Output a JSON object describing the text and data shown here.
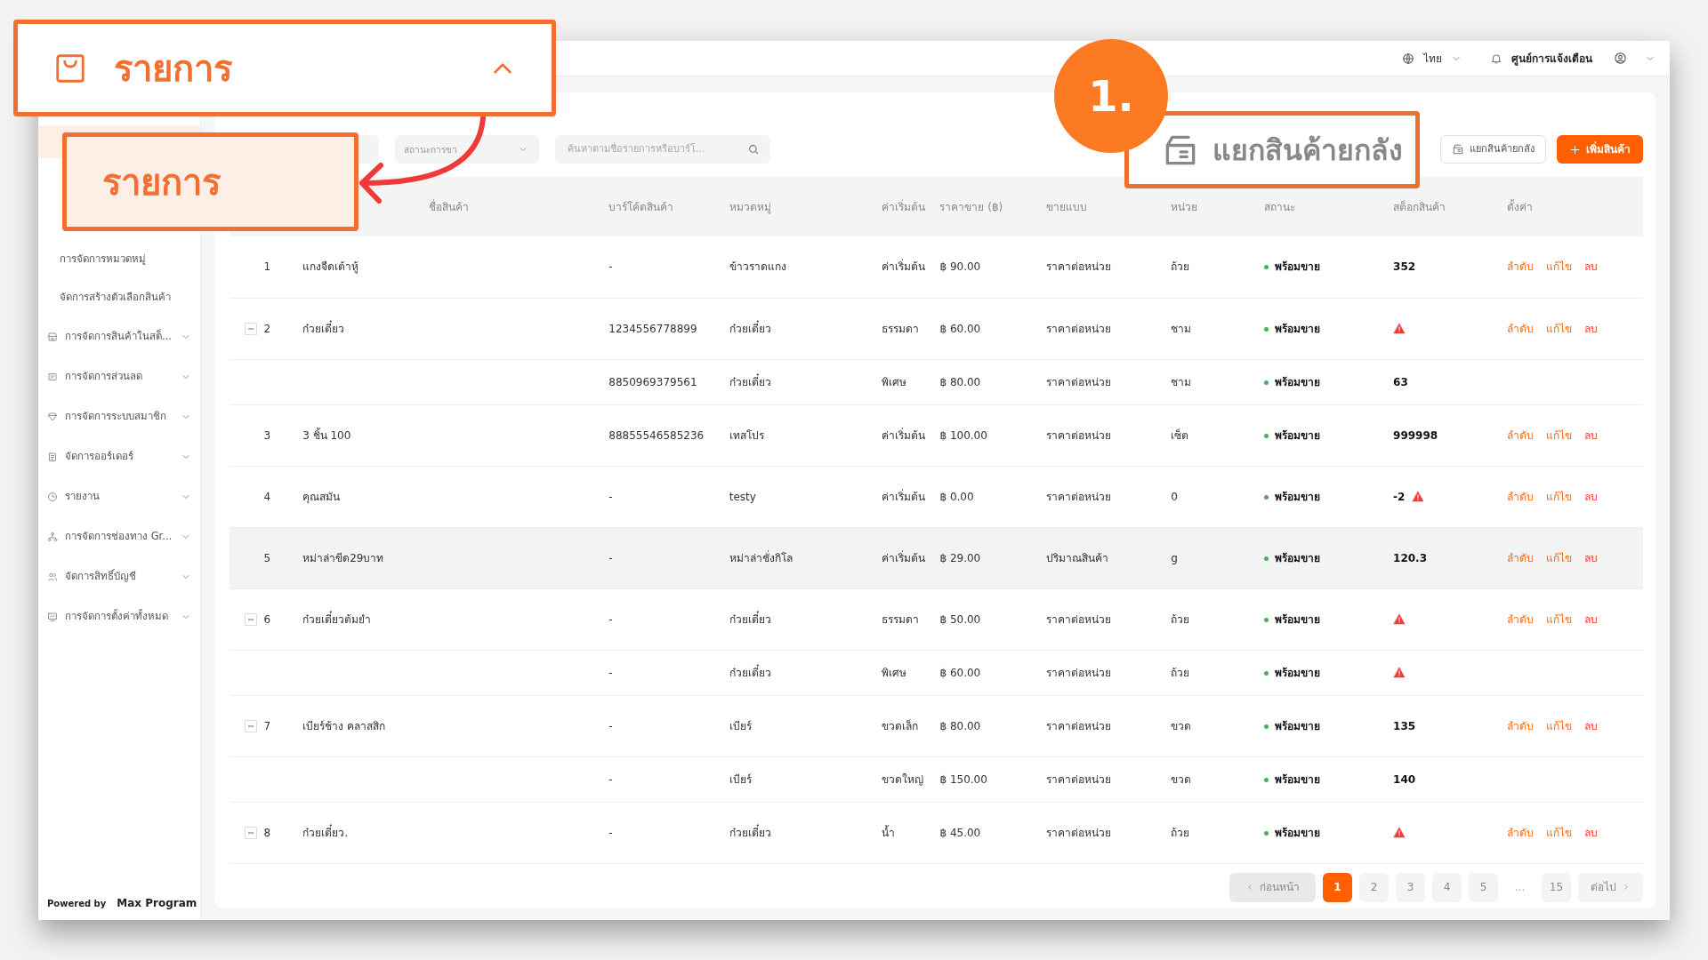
{
  "header": {
    "language": "ไทย",
    "notifications": "ศูนย์การแจ้งเตือน"
  },
  "sidebar": {
    "items": [
      {
        "label": "การจัดการหมวดหมู่",
        "kind": "sub"
      },
      {
        "label": "จัดการสร้างตัวเลือกสินค้า",
        "kind": "sub"
      },
      {
        "label": "การจัดการสินค้าในสต็...",
        "kind": "group",
        "expanded": false
      },
      {
        "label": "การจัดการส่วนลด",
        "kind": "group",
        "expanded": false
      },
      {
        "label": "การจัดการระบบสมาชิก",
        "kind": "group",
        "expanded": false
      },
      {
        "label": "จัดการออร์เดอร์",
        "kind": "group",
        "expanded": false
      },
      {
        "label": "รายงาน",
        "kind": "group",
        "expanded": false
      },
      {
        "label": "การจัดการช่องทาง Gr...",
        "kind": "group",
        "expanded": false
      },
      {
        "label": "จัดการสิทธิ์บัญชี",
        "kind": "group",
        "expanded": false
      },
      {
        "label": "การจัดการตั้งค่าทั้งหมด",
        "kind": "group",
        "expanded": false
      }
    ],
    "footer": {
      "powered_by": "Powered by",
      "brand": "Max Program"
    }
  },
  "filters": {
    "status_placeholder": "สถานะการขา",
    "search_placeholder": "ค้นหาตามชื่อรายการหรือบาร์โ..."
  },
  "actions": {
    "split": "แยกสินค้ายกลัง",
    "add": "เพิ่มสินค้า"
  },
  "table": {
    "columns": [
      "ชื่อสินค้า",
      "บาร์โค้ดสินค้า",
      "หมวดหมู่",
      "ค่าเริ่มต้น",
      "ราคาขาย (฿)",
      "ขายแบบ",
      "หน่วย",
      "สถานะ",
      "สต็อกสินค้า",
      "ตั้งค่า"
    ],
    "rows": [
      {
        "number": "1",
        "name": "แกงจืดเต้าหู้",
        "barcode": "-",
        "category": "ข้าวราดแกง",
        "option": "ค่าเริ่มต้น",
        "price": "฿ 90.00",
        "sale_type": "ราคาต่อหน่วย",
        "unit": "ถ้วย",
        "status": "พร้อมขาย",
        "stock": "352",
        "stock_warning": false,
        "highlighted": false,
        "actions": [
          {
            "label": "ลำดับ",
            "kind": "link"
          },
          {
            "label": "แก้ไข",
            "kind": "link"
          },
          {
            "label": "ลบ",
            "kind": "danger"
          }
        ]
      },
      {
        "number": "2",
        "expanded": true,
        "name": "ก๋วยเตี๋ยว",
        "barcode": "1234556778899",
        "category": "ก๋วยเตี๋ยว",
        "option": "ธรรมดา",
        "price": "฿ 60.00",
        "sale_type": "ราคาต่อหน่วย",
        "unit": "ชาม",
        "status": "พร้อมขาย",
        "stock_warning": true,
        "highlighted": false,
        "actions": [
          {
            "label": "ลำดับ",
            "kind": "link"
          },
          {
            "label": "แก้ไข",
            "kind": "link"
          },
          {
            "label": "ลบ",
            "kind": "danger"
          }
        ],
        "children": [
          {
            "barcode": "8850969379561",
            "category": "ก๋วยเตี๋ยว",
            "option": "พิเศษ",
            "price": "฿ 80.00",
            "sale_type": "ราคาต่อหน่วย",
            "unit": "ชาม",
            "status": "พร้อมขาย",
            "stock": "63",
            "stock_warning": false,
            "highlighted": false
          }
        ]
      },
      {
        "number": "3",
        "name": "3 ชิ้น 100",
        "barcode": "88855546585236",
        "category": "เทสโปร",
        "option": "ค่าเริ่มต้น",
        "price": "฿ 100.00",
        "sale_type": "ราคาต่อหน่วย",
        "unit": "เซ็ต",
        "status": "พร้อมขาย",
        "stock": "999998",
        "stock_warning": false,
        "highlighted": false,
        "actions": [
          {
            "label": "ลำดับ",
            "kind": "link"
          },
          {
            "label": "แก้ไข",
            "kind": "link"
          },
          {
            "label": "ลบ",
            "kind": "danger"
          }
        ]
      },
      {
        "number": "4",
        "name": "คุณสมัน",
        "barcode": "-",
        "category": "testy",
        "option": "ค่าเริ่มต้น",
        "price": "฿ 0.00",
        "sale_type": "ราคาต่อหน่วย",
        "unit": "0",
        "status": "พร้อมขาย",
        "stock": "-2",
        "stock_warning": true,
        "highlighted": false,
        "actions": [
          {
            "label": "ลำดับ",
            "kind": "link"
          },
          {
            "label": "แก้ไข",
            "kind": "link"
          },
          {
            "label": "ลบ",
            "kind": "danger"
          }
        ]
      },
      {
        "number": "5",
        "name": "หม่าล่าขีด29บาท",
        "barcode": "-",
        "category": "หม่าล่าชั่งกิโล",
        "option": "ค่าเริ่มต้น",
        "price": "฿ 29.00",
        "sale_type": "ปริมาณสินค้า",
        "unit": "g",
        "status": "พร้อมขาย",
        "stock": "120.3",
        "stock_warning": false,
        "highlighted": true,
        "actions": [
          {
            "label": "ลำดับ",
            "kind": "link"
          },
          {
            "label": "แก้ไข",
            "kind": "link"
          },
          {
            "label": "ลบ",
            "kind": "danger"
          }
        ]
      },
      {
        "number": "6",
        "expanded": true,
        "name": "ก๋วยเตี๋ยวต้มยำ",
        "barcode": "-",
        "category": "ก๋วยเตี๋ยว",
        "option": "ธรรมดา",
        "price": "฿ 50.00",
        "sale_type": "ราคาต่อหน่วย",
        "unit": "ถ้วย",
        "status": "พร้อมขาย",
        "stock_warning": true,
        "highlighted": false,
        "actions": [
          {
            "label": "ลำดับ",
            "kind": "link"
          },
          {
            "label": "แก้ไข",
            "kind": "link"
          },
          {
            "label": "ลบ",
            "kind": "danger"
          }
        ],
        "children": [
          {
            "barcode": "-",
            "category": "ก๋วยเตี๋ยว",
            "option": "พิเศษ",
            "price": "฿ 60.00",
            "sale_type": "ราคาต่อหน่วย",
            "unit": "ถ้วย",
            "status": "พร้อมขาย",
            "stock_warning": true,
            "highlighted": false
          }
        ]
      },
      {
        "number": "7",
        "expanded": true,
        "name": "เบียร์ช้าง คลาสสิก",
        "barcode": "-",
        "category": "เบียร์",
        "option": "ขวดเล็ก",
        "price": "฿ 80.00",
        "sale_type": "ราคาต่อหน่วย",
        "unit": "ขวด",
        "status": "พร้อมขาย",
        "stock": "135",
        "stock_warning": false,
        "highlighted": false,
        "actions": [
          {
            "label": "ลำดับ",
            "kind": "link"
          },
          {
            "label": "แก้ไข",
            "kind": "link"
          },
          {
            "label": "ลบ",
            "kind": "danger"
          }
        ],
        "children": [
          {
            "barcode": "-",
            "category": "เบียร์",
            "option": "ขวดใหญ่",
            "price": "฿ 150.00",
            "sale_type": "ราคาต่อหน่วย",
            "unit": "ขวด",
            "status": "พร้อมขาย",
            "stock": "140",
            "stock_warning": false,
            "highlighted": false
          }
        ]
      },
      {
        "number": "8",
        "expanded": true,
        "name": "ก๋วยเตี๋ยว.",
        "barcode": "-",
        "category": "ก๋วยเตี๋ยว",
        "option": "น้ำ",
        "price": "฿ 45.00",
        "sale_type": "ราคาต่อหน่วย",
        "unit": "ถ้วย",
        "status": "พร้อมขาย",
        "stock_warning": true,
        "highlighted": false,
        "actions": [
          {
            "label": "ลำดับ",
            "kind": "link"
          },
          {
            "label": "แก้ไข",
            "kind": "link"
          },
          {
            "label": "ลบ",
            "kind": "danger"
          }
        ]
      }
    ]
  },
  "pagination": {
    "previous": {
      "label": "ก่อนหน้า",
      "disabled": true
    },
    "pages": [
      {
        "label": "1",
        "selected": true
      },
      {
        "label": "2",
        "selected": false
      },
      {
        "label": "3",
        "selected": false
      },
      {
        "label": "4",
        "selected": false
      },
      {
        "label": "5",
        "selected": false
      },
      {
        "label": "...",
        "kind": "ellipsis"
      },
      {
        "label": "15",
        "selected": false
      }
    ],
    "next": {
      "label": "ต่อไป",
      "disabled": false
    }
  },
  "callouts": {
    "menu_group": {
      "label": "รายการ",
      "expanded": true
    },
    "menu_item": {
      "label": "รายการ"
    },
    "step": {
      "label": "1."
    },
    "button": {
      "label": "แยกสินค้ายกลัง"
    }
  }
}
